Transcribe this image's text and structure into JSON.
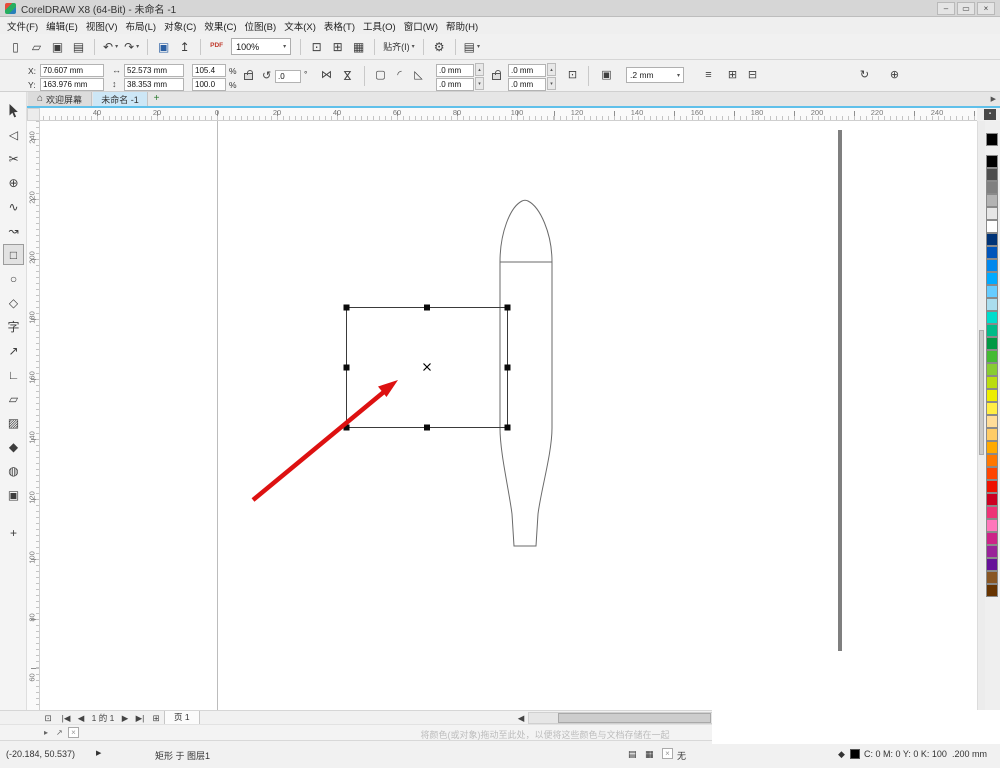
{
  "titlebar": {
    "title": "CorelDRAW X8 (64-Bit) - 未命名 -1",
    "minimize_glyph": "–",
    "maximize_glyph": "▭",
    "close_glyph": "×"
  },
  "menus": [
    "文件(F)",
    "编辑(E)",
    "视图(V)",
    "布局(L)",
    "对象(C)",
    "效果(C)",
    "位图(B)",
    "文本(X)",
    "表格(T)",
    "工具(O)",
    "窗口(W)",
    "帮助(H)"
  ],
  "toolbar": {
    "items": [
      {
        "name": "new-document-button",
        "glyph": "▯"
      },
      {
        "name": "open-document-button",
        "glyph": "▱"
      },
      {
        "name": "save-document-button",
        "glyph": "▣"
      },
      {
        "name": "print-button",
        "glyph": "▤"
      },
      {
        "sep": true
      },
      {
        "name": "undo-button",
        "glyph": "↶",
        "dropdown": true
      },
      {
        "name": "redo-button",
        "glyph": "↷",
        "dropdown": true
      },
      {
        "sep": true
      },
      {
        "name": "import-button",
        "glyph": "▣",
        "accent": true
      },
      {
        "name": "export-button",
        "glyph": "↥"
      },
      {
        "sep": true
      },
      {
        "name": "publish-pdf-button",
        "glyph": "PDF",
        "small": true
      },
      {
        "name": "zoom-level-combo",
        "combo": "100%"
      },
      {
        "sep": true
      },
      {
        "name": "fullscreen-preview-button",
        "glyph": "⊡"
      },
      {
        "name": "show-rulers-button",
        "glyph": "⊞"
      },
      {
        "name": "show-grid-button",
        "glyph": "▦"
      },
      {
        "sep": true
      },
      {
        "name": "snap-to-dropdown",
        "label": "贴齐(I)",
        "dropdown": true
      },
      {
        "sep": true
      },
      {
        "name": "options-button",
        "glyph": "⚙"
      },
      {
        "sep": true
      },
      {
        "name": "launch-dropdown",
        "glyph": "▤",
        "dropdown": true
      }
    ]
  },
  "property_bar": {
    "x_label": "X:",
    "x_value": "70.607 mm",
    "y_label": "Y:",
    "y_value": "163.976 mm",
    "width_value": "52.573 mm",
    "height_value": "38.353 mm",
    "scale_width": "105.4",
    "scale_height": "100.0",
    "percent": "%",
    "angle_value": ".0",
    "degree": "°",
    "corner_top_left": ".0 mm",
    "corner_top_right": ".0 mm",
    "corner_bottom_left": ".0 mm",
    "corner_bottom_right": ".0 mm",
    "outline_width_value": ".2 mm"
  },
  "document_tabs": {
    "welcome_label": "欢迎屏幕",
    "document_label": "未命名 -1",
    "add_label": "+"
  },
  "rulers": {
    "horizontal_labels": [
      "40",
      "20",
      "0",
      "20",
      "40",
      "60",
      "80",
      "100",
      "120",
      "140",
      "160",
      "180",
      "200",
      "220",
      "240"
    ],
    "vertical_labels": [
      "240",
      "220",
      "200",
      "180",
      "160",
      "140",
      "120",
      "100",
      "80",
      "60"
    ]
  },
  "toolbox": [
    {
      "name": "pick-tool"
    },
    {
      "name": "shape-tool",
      "glyph": "◁"
    },
    {
      "name": "crop-tool",
      "glyph": "✂"
    },
    {
      "name": "zoom-tool",
      "glyph": "⊕"
    },
    {
      "name": "freehand-tool",
      "glyph": "∿"
    },
    {
      "name": "artistic-media-tool",
      "glyph": "↝"
    },
    {
      "name": "rectangle-tool",
      "glyph": "□",
      "active": true
    },
    {
      "name": "ellipse-tool",
      "glyph": "○"
    },
    {
      "name": "polygon-tool",
      "glyph": "◇"
    },
    {
      "name": "text-tool",
      "glyph": "字"
    },
    {
      "name": "parallel-dimension-tool",
      "glyph": "↗"
    },
    {
      "name": "connector-tool",
      "glyph": "∟"
    },
    {
      "name": "drop-shadow-tool",
      "glyph": "▱"
    },
    {
      "name": "transparency-tool",
      "glyph": "▨"
    },
    {
      "name": "color-eyedropper-tool",
      "glyph": "◆"
    },
    {
      "name": "interactive-fill-tool",
      "glyph": "◍"
    },
    {
      "name": "smart-fill-tool",
      "glyph": "▣"
    },
    {
      "name": "customize-toolbox-button",
      "glyph": "+",
      "last": true
    }
  ],
  "color_palette": [
    "#000000",
    "#4d4d4d",
    "#808080",
    "#b3b3b3",
    "#e6e6e6",
    "#ffffff",
    "#003377",
    "#0055bb",
    "#0088ee",
    "#00aaff",
    "#66ccff",
    "#aaddee",
    "#00ddcc",
    "#00bb88",
    "#009944",
    "#44bb33",
    "#88cc33",
    "#bbdd11",
    "#eeee00",
    "#ffee44",
    "#ffdd99",
    "#ffcc66",
    "#ffaa00",
    "#ff7700",
    "#ff4400",
    "#ee1100",
    "#cc0022",
    "#ee3377",
    "#ff77bb",
    "#cc2288",
    "#992299",
    "#661199",
    "#885522",
    "#663300"
  ],
  "page_nav": {
    "page_counter": "1 的 1",
    "page_tab_label": "页 1"
  },
  "hint": "将颜色(或对象)拖动至此处，以便将这些颜色与文档存储在一起",
  "status_bar": {
    "cursor_position": "(-20.184, 50.537)",
    "object_info": "矩形 于 图层1",
    "fill_label": "无",
    "outline_color": "C: 0 M: 0 Y: 0 K: 100",
    "outline_width": ".200 mm"
  },
  "colors": {
    "accent_blue": "#2b5fa3",
    "pdf_red": "#c0392b",
    "arrow_red": "#dd1111",
    "tab_highlight": "#cde7f6"
  },
  "icons": {
    "dropdown": "▾",
    "spin_up": "▴",
    "spin_down": "▾",
    "size_h": "↔",
    "size_v": "↕",
    "angle": "↺",
    "mirror_h": "⋈",
    "mirror_v": "⋈",
    "corner_square": "▢",
    "corner_round": "◜",
    "corner_chamfer": "◺",
    "relative": "⊡",
    "wrap": "▣",
    "align": "≡",
    "order_a": "⊞",
    "order_b": "⊟",
    "refresh": "↻",
    "plus": "⊕",
    "home": "⌂",
    "tab_scroll": "▶",
    "page_flyout": "⊡",
    "nav_first": "|◀",
    "nav_prev": "◀",
    "nav_next": "▶",
    "nav_last": "▶|",
    "add_page": "⊞",
    "hscroll_left": "◀",
    "flyout": "▸",
    "eyedrop": "↗",
    "cross": "×",
    "doc": "▤",
    "grid": "▦",
    "pen": "◆",
    "play": "▶",
    "ruler_corner": "▪"
  }
}
